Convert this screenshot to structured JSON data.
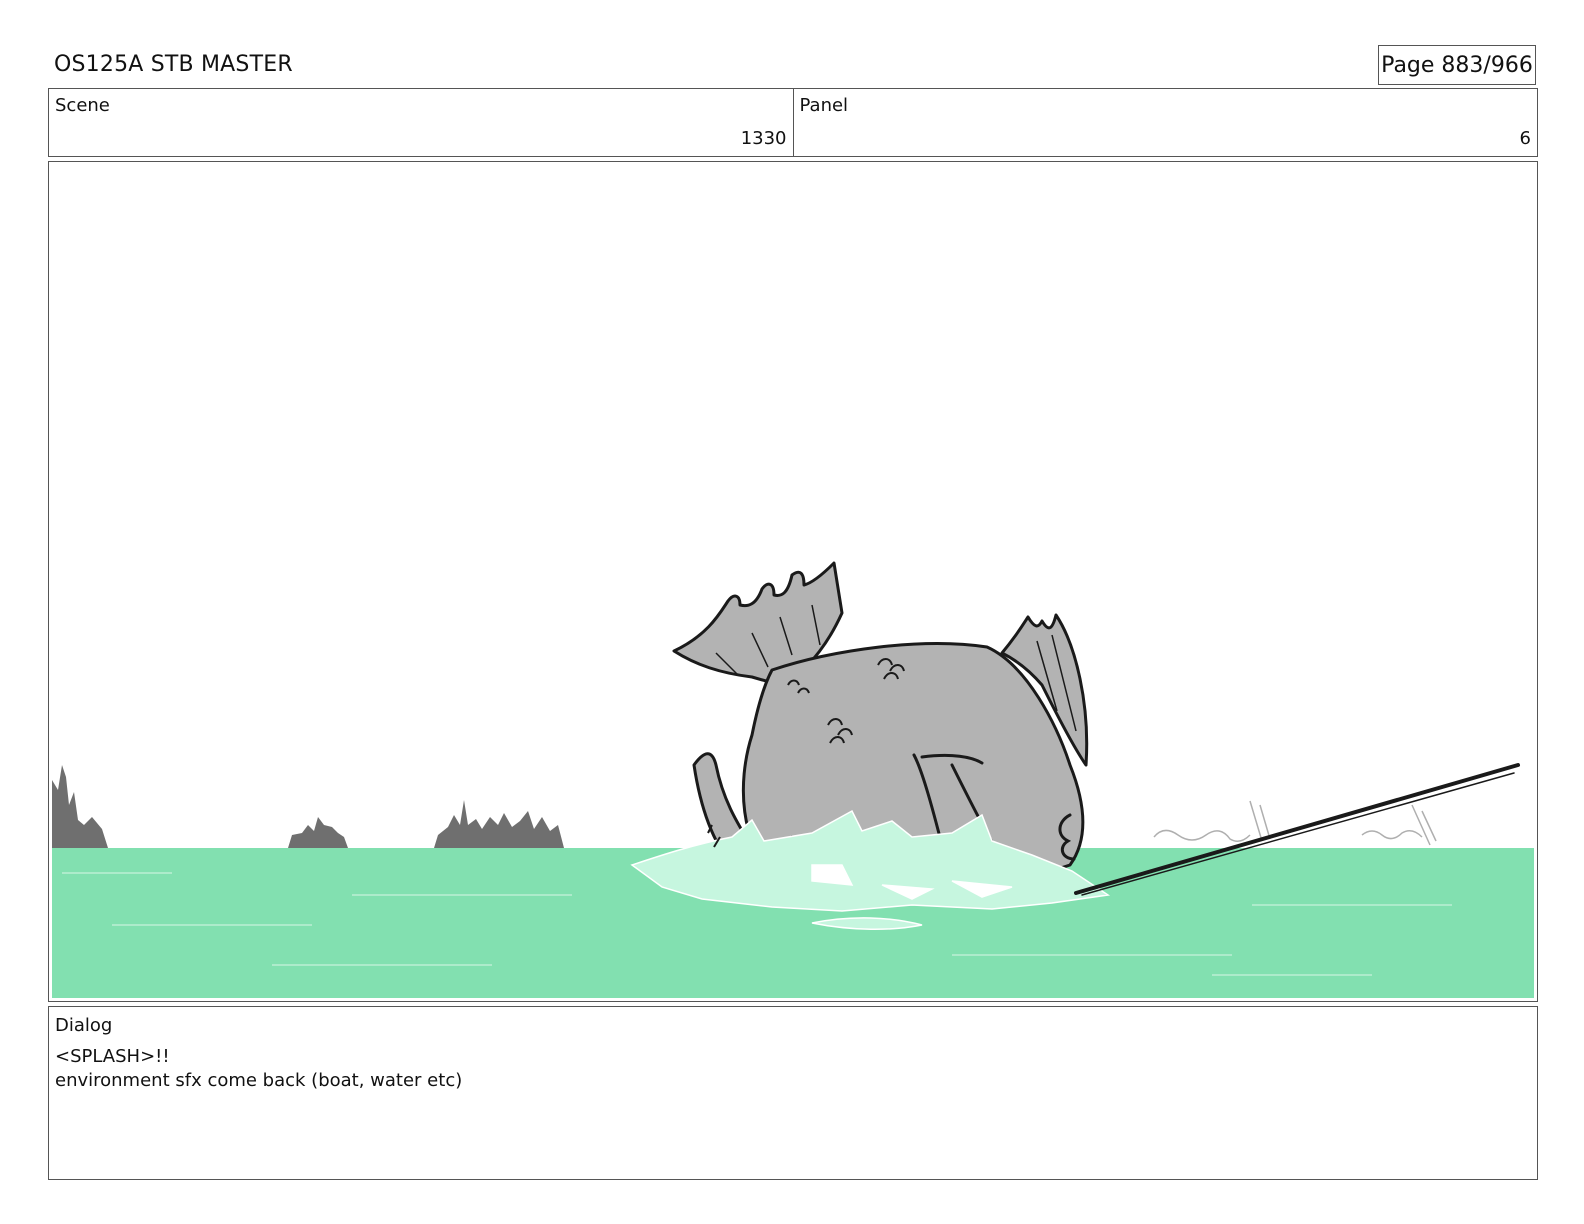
{
  "header": {
    "title": "OS125A STB MASTER",
    "page": "Page 883/966"
  },
  "info": {
    "scene_label": "Scene",
    "scene_value": "1330",
    "panel_label": "Panel",
    "panel_value": "6"
  },
  "panel_art": {
    "sky_color": "#ffffff",
    "water_color": "#82e0b0",
    "splash_color": "#c6f6df",
    "fish_color": "#b3b3b3",
    "distant_land_color": "#6f6f6f",
    "line_color": "#1a1a1a"
  },
  "dialog": {
    "label": "Dialog",
    "lines": [
      "<SPLASH>!!",
      "environment sfx come back (boat, water etc)"
    ]
  }
}
